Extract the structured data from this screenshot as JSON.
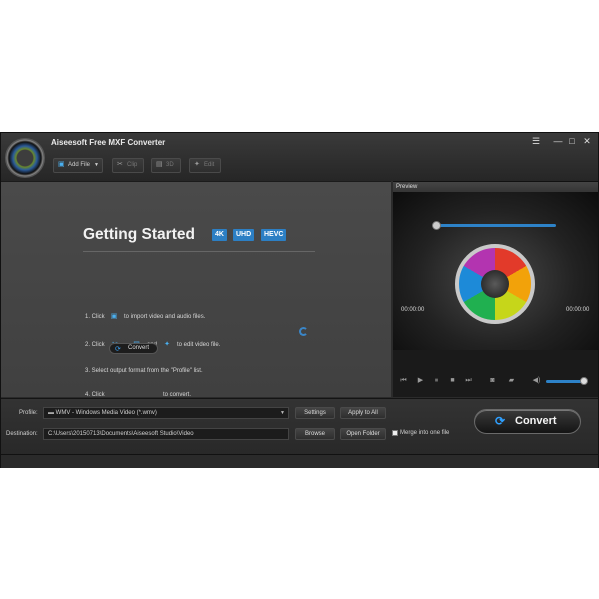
{
  "window": {
    "title": "Aiseesoft Free MXF Converter",
    "controls": [
      "feedback-icon",
      "minimize-icon",
      "maximize-icon",
      "close-icon"
    ]
  },
  "toolbar": {
    "add_file": "Add File",
    "clip": "Clip",
    "three_d": "3D",
    "edit": "Edit"
  },
  "getting_started": {
    "title": "Getting Started",
    "badges": [
      "4K",
      "UHD",
      "HEVC"
    ],
    "step1": {
      "prefix": "1. Click",
      "suffix": "to import video and audio files."
    },
    "step2": {
      "prefix": "2. Click",
      "sep": ",",
      "and": "and",
      "suffix": "to edit video file."
    },
    "step3": "3. Select output format from the \"Profile\" list.",
    "step4": {
      "prefix": "4. Click",
      "button": "Convert",
      "suffix": "to convert."
    }
  },
  "preview": {
    "header": "Preview",
    "time_current": "00:00:00",
    "time_total": "00:00:00",
    "volume_level": 0.85
  },
  "profile": {
    "label": "Profile:",
    "value": "WMV - Windows Media Video (*.wmv)",
    "settings": "Settings",
    "apply_all": "Apply to All"
  },
  "destination": {
    "label": "Destination:",
    "value": "C:\\Users\\20150713\\Documents\\Aiseesoft Studio\\Video",
    "browse": "Browse",
    "open_folder": "Open Folder",
    "merge_label": "Merge into one file"
  },
  "convert_label": "Convert",
  "colors": {
    "accent": "#2c7fc4",
    "background": "#2b2b2b"
  }
}
